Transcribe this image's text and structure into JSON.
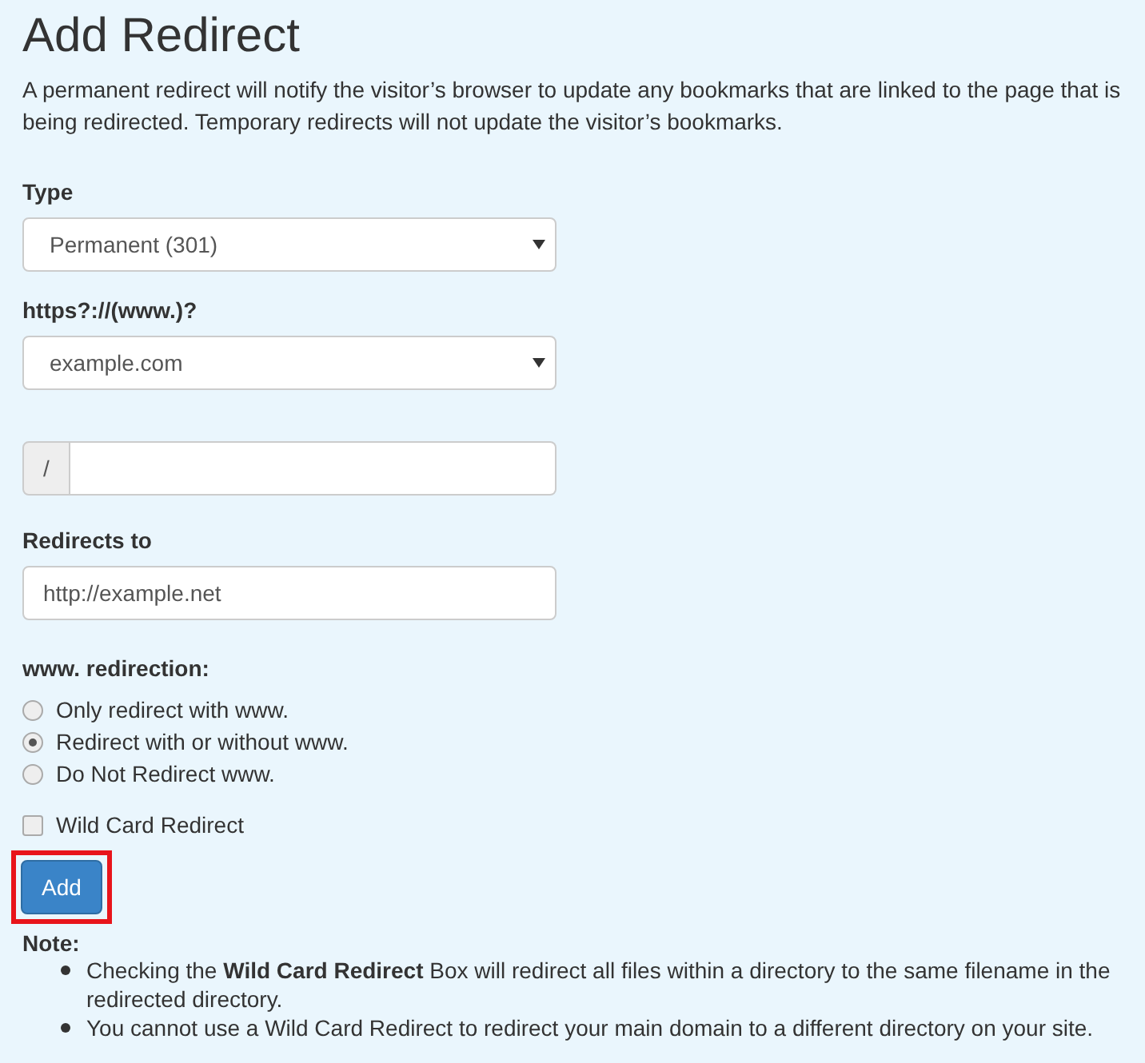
{
  "title": "Add Redirect",
  "intro": "A permanent redirect will notify the visitor’s browser to update any bookmarks that are linked to the page that is being redirected. Temporary redirects will not update the visitor’s bookmarks.",
  "type_field": {
    "label": "Type",
    "value": "Permanent (301)"
  },
  "domain_field": {
    "label": "https?://(www.)?",
    "value": "example.com"
  },
  "path_field": {
    "prefix": "/"
  },
  "target_field": {
    "label": "Redirects to",
    "placeholder": "http://example.net"
  },
  "www_redirection": {
    "label": "www. redirection:",
    "options": [
      {
        "label": "Only redirect with www.",
        "selected": false
      },
      {
        "label": "Redirect with or without www.",
        "selected": true
      },
      {
        "label": "Do Not Redirect www.",
        "selected": false
      }
    ]
  },
  "wildcard": {
    "label": "Wild Card Redirect",
    "checked": false
  },
  "add_button": {
    "label": "Add",
    "highlighted": true
  },
  "note": {
    "label": "Note:",
    "items": [
      "Checking the **Wild Card Redirect** Box will redirect all files within a directory to the same filename in the redirected directory.",
      "You cannot use a Wild Card Redirect to redirect your main domain to a different directory on your site."
    ]
  }
}
